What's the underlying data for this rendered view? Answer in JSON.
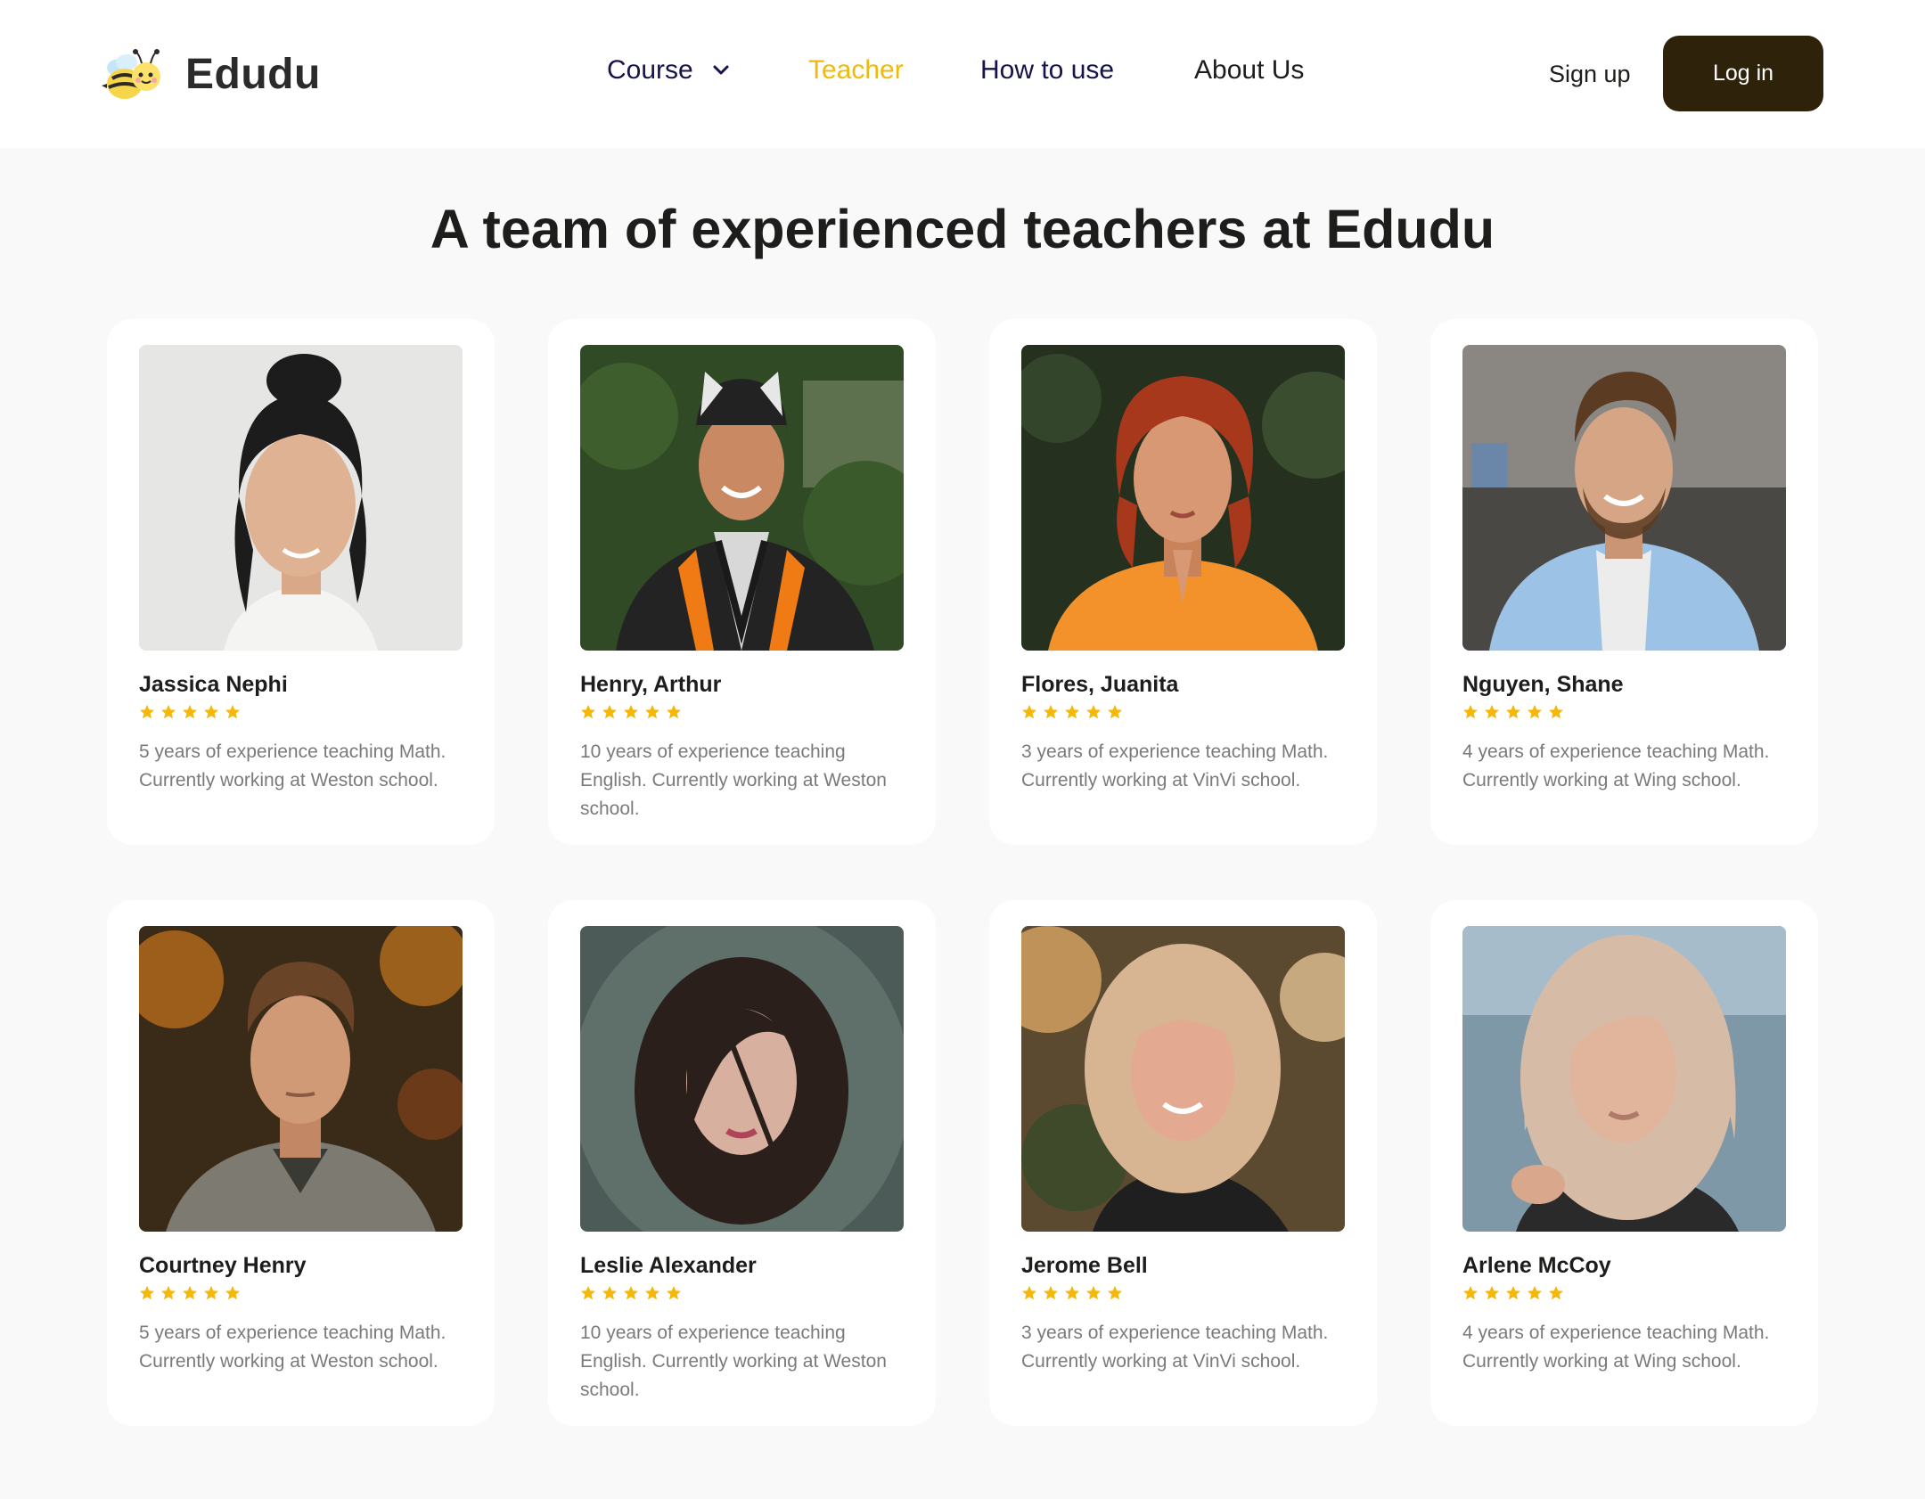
{
  "brand": {
    "name": "Edudu",
    "logo_icon": "bee-icon"
  },
  "nav": {
    "course": "Course",
    "teacher": "Teacher",
    "how_to_use": "How to use",
    "about_us": "About Us",
    "active": "Teacher"
  },
  "auth": {
    "sign_up": "Sign up",
    "log_in": "Log in"
  },
  "page": {
    "title": "A team of experienced teachers at Edudu"
  },
  "colors": {
    "accent": "#f0b90b",
    "dark_button": "#2e220b",
    "nav_text": "#15134a",
    "background": "#f9f9f9"
  },
  "teachers": [
    {
      "name": "Jassica Nephi",
      "rating": 5,
      "description": "5 years of experience teaching Math. Currently working at Weston school."
    },
    {
      "name": "Henry, Arthur",
      "rating": 5,
      "description": "10 years of experience teaching English. Currently working at Weston school."
    },
    {
      "name": "Flores, Juanita",
      "rating": 5,
      "description": "3 years of experience teaching Math. Currently working at VinVi school."
    },
    {
      "name": "Nguyen, Shane",
      "rating": 5,
      "description": "4 years of experience teaching Math. Currently working at Wing school."
    },
    {
      "name": "Courtney Henry",
      "rating": 5,
      "description": "5 years of experience teaching Math. Currently working at Weston school."
    },
    {
      "name": "Leslie Alexander",
      "rating": 5,
      "description": "10 years of experience teaching English. Currently working at Weston school."
    },
    {
      "name": "Jerome Bell",
      "rating": 5,
      "description": "3 years of experience teaching Math. Currently working at VinVi school."
    },
    {
      "name": "Arlene McCoy",
      "rating": 5,
      "description": "4 years of experience teaching Math. Currently working at Wing school."
    }
  ]
}
